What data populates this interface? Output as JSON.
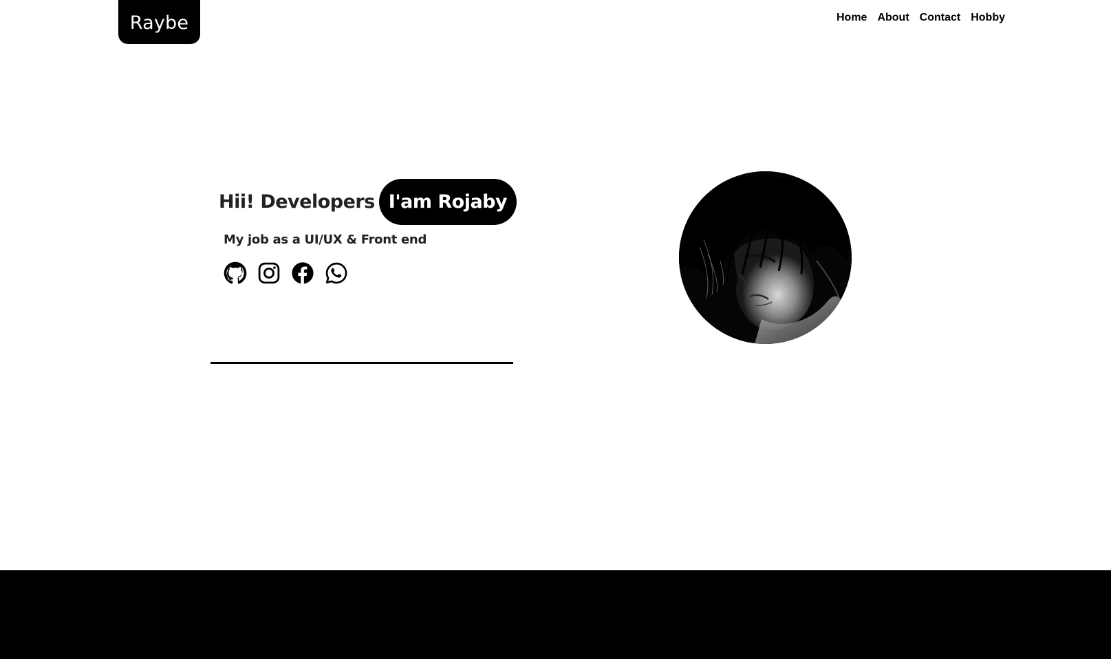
{
  "header": {
    "logo": "Raybe",
    "nav": [
      "Home",
      "About",
      "Contact",
      "Hobby"
    ]
  },
  "hero": {
    "greeting": "Hii! Developers",
    "name_pill": "I'am Rojaby",
    "subtitle": "My job as a UI/UX & Front end",
    "socials": [
      "github-icon",
      "instagram-icon",
      "facebook-icon",
      "whatsapp-icon"
    ]
  },
  "colors": {
    "primary": "#000000",
    "text": "#222222",
    "background": "#ffffff"
  }
}
